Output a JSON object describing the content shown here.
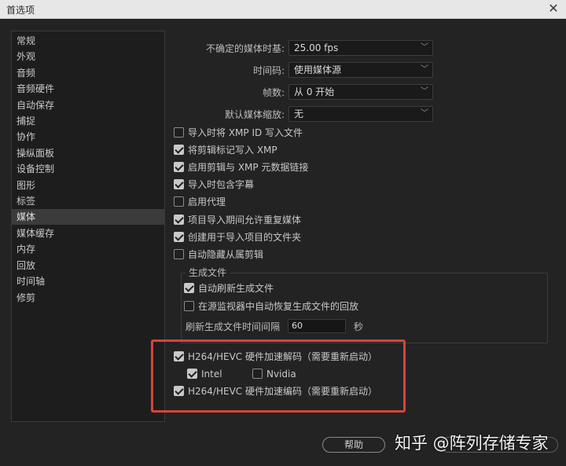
{
  "window": {
    "title": "首选项",
    "close_icon": "close-icon"
  },
  "sidebar": {
    "items": [
      {
        "label": "常规"
      },
      {
        "label": "外观"
      },
      {
        "label": "音频"
      },
      {
        "label": "音频硬件"
      },
      {
        "label": "自动保存"
      },
      {
        "label": "捕捉"
      },
      {
        "label": "协作"
      },
      {
        "label": "操纵面板"
      },
      {
        "label": "设备控制"
      },
      {
        "label": "图形"
      },
      {
        "label": "标签"
      },
      {
        "label": "媒体"
      },
      {
        "label": "媒体缓存"
      },
      {
        "label": "内存"
      },
      {
        "label": "回放"
      },
      {
        "label": "时间轴"
      },
      {
        "label": "修剪"
      }
    ],
    "selected": "媒体"
  },
  "media": {
    "timebase": {
      "label": "不确定的媒体时基:",
      "value": "25.00 fps"
    },
    "timecode": {
      "label": "时间码:",
      "value": "使用媒体源"
    },
    "frames": {
      "label": "帧数:",
      "value": "从 0 开始"
    },
    "scale": {
      "label": "默认媒体缩放:",
      "value": "无"
    },
    "checkboxes": [
      {
        "label": "导入时将 XMP ID 写入文件",
        "checked": false
      },
      {
        "label": "将剪辑标记写入 XMP",
        "checked": true
      },
      {
        "label": "启用剪辑与 XMP 元数据链接",
        "checked": true
      },
      {
        "label": "导入时包含字幕",
        "checked": true
      },
      {
        "label": "启用代理",
        "checked": false
      },
      {
        "label": "项目导入期间允许重复媒体",
        "checked": true
      },
      {
        "label": "创建用于导入项目的文件夹",
        "checked": true
      },
      {
        "label": "自动隐藏从属剪辑",
        "checked": false
      }
    ]
  },
  "generated": {
    "title": "生成文件",
    "auto_refresh": {
      "label": "自动刷新生成文件",
      "checked": true
    },
    "auto_resume": {
      "label": "在源监视器中自动恢复生成文件的回放",
      "checked": false
    },
    "interval_label": "刷新生成文件时间间隔",
    "interval_value": "60",
    "interval_unit": "秒"
  },
  "hardware": {
    "decode": {
      "label": "H264/HEVC 硬件加速解码（需要重新启动）",
      "checked": true
    },
    "intel": {
      "label": "Intel",
      "checked": true
    },
    "nvidia": {
      "label": "Nvidia",
      "checked": false
    },
    "encode": {
      "label": "H264/HEVC 硬件加速编码（需要重新启动）",
      "checked": true
    }
  },
  "footer": {
    "help_label": "帮助"
  },
  "watermark": {
    "text": "知乎 @阵列存储专家"
  },
  "colors": {
    "background": "#232323",
    "highlight": "#d5453b",
    "panel": "#1d1d1d"
  }
}
